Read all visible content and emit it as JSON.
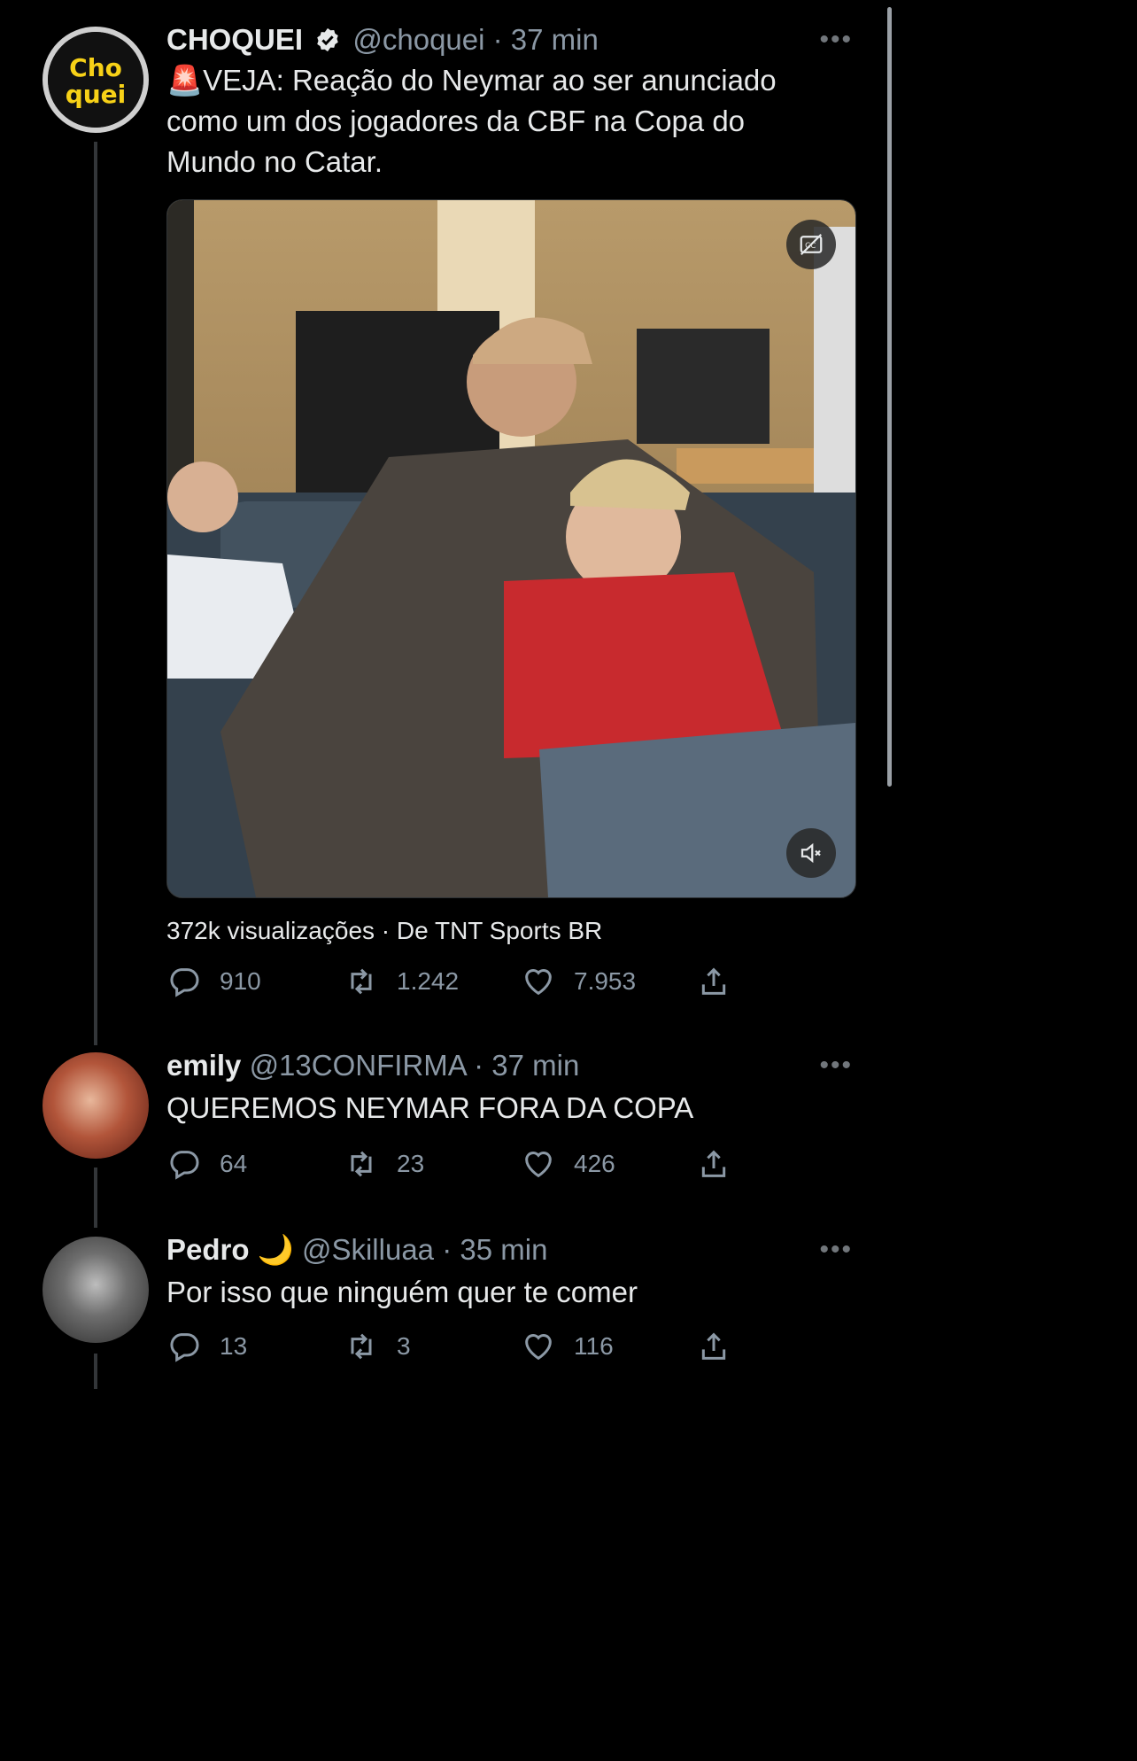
{
  "main_tweet": {
    "author_name": "CHOQUEI",
    "handle": "@choquei",
    "time": "· 37 min",
    "avatar_text_top": "Cho",
    "avatar_text_bottom": "quei",
    "emoji": "🚨",
    "text": "VEJA: Reação do Neymar ao ser anunciado como um dos jogadores da CBF na Copa do Mundo no Catar.",
    "views": "372k visualizações · De TNT Sports BR",
    "replies": "910",
    "retweets": "1.242",
    "likes": "7.953"
  },
  "reply1": {
    "author_name": "emily",
    "handle": "@13CONFIRMA",
    "time": "· 37 min",
    "text": "QUEREMOS NEYMAR FORA DA COPA",
    "replies": "64",
    "retweets": "23",
    "likes": "426"
  },
  "reply2": {
    "author_name": "Pedro",
    "emoji": "🌙",
    "handle": "@Skilluaa",
    "time": "· 35 min",
    "text": "Por isso que ninguém quer te comer",
    "replies": "13",
    "retweets": "3",
    "likes": "116"
  },
  "more_label": "•••",
  "colors": {
    "background": "#000000",
    "text": "#e7e9ea",
    "muted": "#8b98a5",
    "verified": "#e7e9ea",
    "avatar_yellow": "#f7d117"
  },
  "icons": [
    "reply-icon",
    "retweet-icon",
    "like-icon",
    "share-icon",
    "verified-icon",
    "captions-off-icon",
    "mute-icon",
    "more-icon"
  ]
}
